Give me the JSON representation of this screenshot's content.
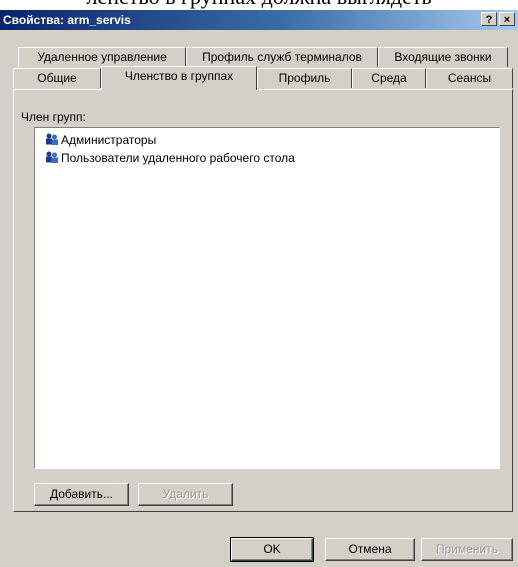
{
  "caption": "ленство в группах должна выглядеть",
  "window": {
    "title": "Свойства: arm_servis",
    "help_btn": "?",
    "close_btn": "×"
  },
  "tabs_row1": [
    "Удаленное управление",
    "Профиль служб терминалов",
    "Входящие звонки"
  ],
  "tabs_row2": [
    "Общие",
    "Членство в группах",
    "Профиль",
    "Среда",
    "Сеансы"
  ],
  "active_tab": "Членство в группах",
  "panel": {
    "label": "Член групп:",
    "items": [
      "Администраторы",
      "Пользователи удаленного рабочего стола"
    ]
  },
  "buttons": {
    "add": "Добавить...",
    "remove": "Удалить",
    "ok": "OK",
    "cancel": "Отмена",
    "apply": "Применить"
  },
  "icons": {
    "group": "group-icon"
  }
}
